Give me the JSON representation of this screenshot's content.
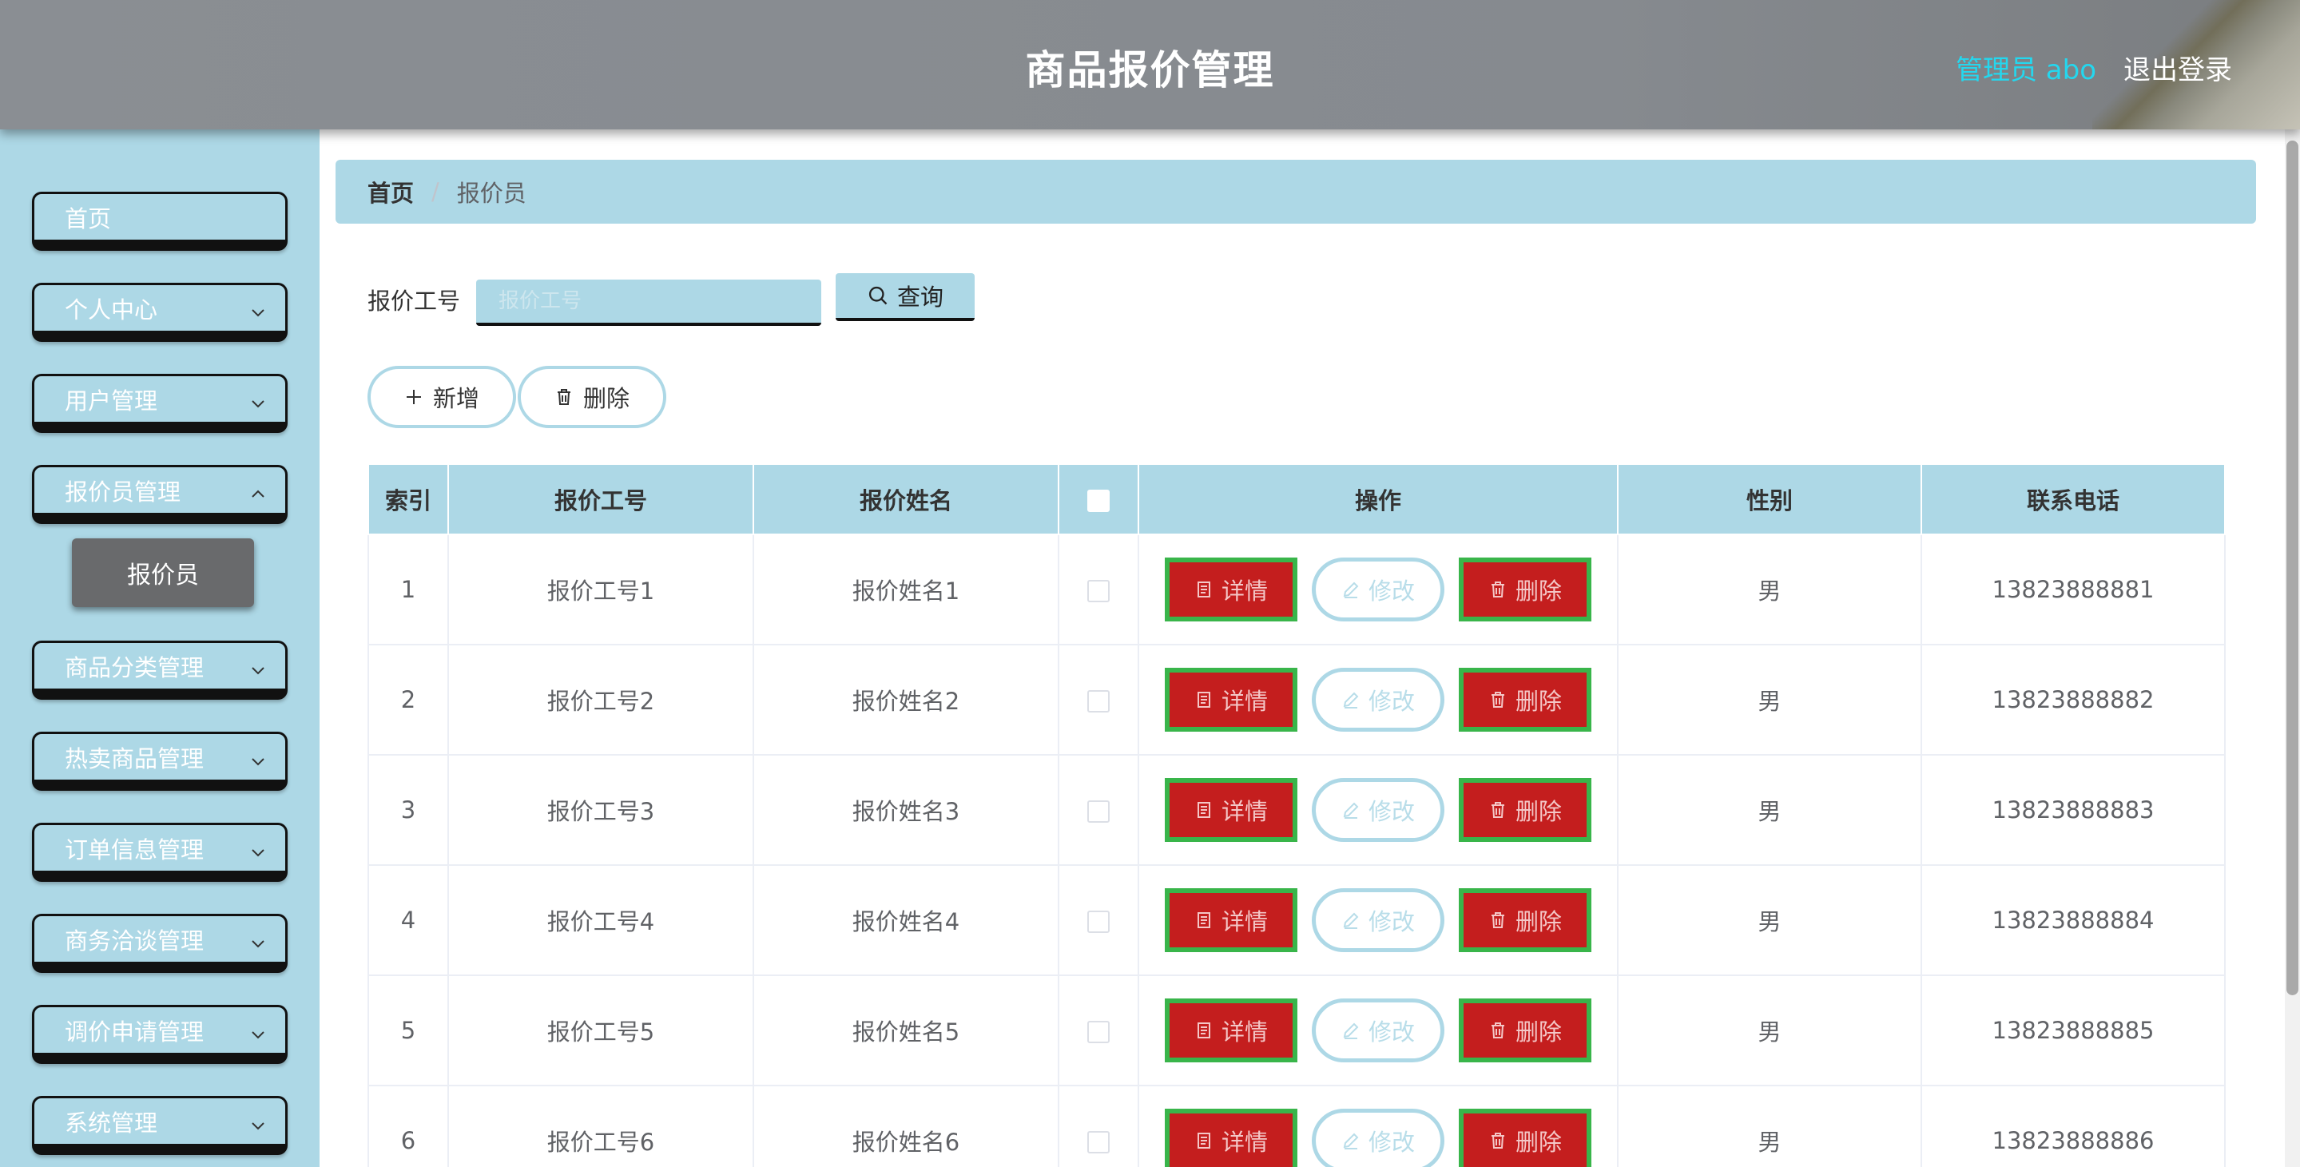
{
  "header": {
    "title": "商品报价管理",
    "user": "管理员 abo",
    "logout": "退出登录"
  },
  "sidebar": {
    "items": [
      {
        "label": "首页",
        "has_children": false
      },
      {
        "label": "个人中心",
        "has_children": true
      },
      {
        "label": "用户管理",
        "has_children": true
      },
      {
        "label": "报价员管理",
        "has_children": true
      },
      {
        "label": "商品分类管理",
        "has_children": true
      },
      {
        "label": "热卖商品管理",
        "has_children": true
      },
      {
        "label": "订单信息管理",
        "has_children": true
      },
      {
        "label": "商务洽谈管理",
        "has_children": true
      },
      {
        "label": "调价申请管理",
        "has_children": true
      },
      {
        "label": "系统管理",
        "has_children": true
      }
    ],
    "active_sub": "报价员"
  },
  "breadcrumb": {
    "home": "首页",
    "separator": "/",
    "current": "报价员"
  },
  "search": {
    "label": "报价工号",
    "placeholder": "报价工号",
    "button": "查询"
  },
  "actions": {
    "add": "新增",
    "delete": "删除"
  },
  "table": {
    "columns": [
      "索引",
      "报价工号",
      "报价姓名",
      "",
      "操作",
      "性别",
      "联系电话"
    ],
    "ops": {
      "detail": "详情",
      "edit": "修改",
      "delete": "删除"
    },
    "rows": [
      {
        "index": "1",
        "code": "报价工号1",
        "name": "报价姓名1",
        "gender": "男",
        "phone": "13823888881"
      },
      {
        "index": "2",
        "code": "报价工号2",
        "name": "报价姓名2",
        "gender": "男",
        "phone": "13823888882"
      },
      {
        "index": "3",
        "code": "报价工号3",
        "name": "报价姓名3",
        "gender": "男",
        "phone": "13823888883"
      },
      {
        "index": "4",
        "code": "报价工号4",
        "name": "报价姓名4",
        "gender": "男",
        "phone": "13823888884"
      },
      {
        "index": "5",
        "code": "报价工号5",
        "name": "报价姓名5",
        "gender": "男",
        "phone": "13823888885"
      },
      {
        "index": "6",
        "code": "报价工号6",
        "name": "报价姓名6",
        "gender": "男",
        "phone": "13823888886"
      }
    ]
  },
  "colors": {
    "header_bg": "#878b90",
    "accent_light_blue": "#add8e6",
    "user_text": "#24d7ee",
    "danger_red": "#c41e1e",
    "danger_border_green": "#39b54a",
    "sub_item_bg": "#696a6c"
  }
}
